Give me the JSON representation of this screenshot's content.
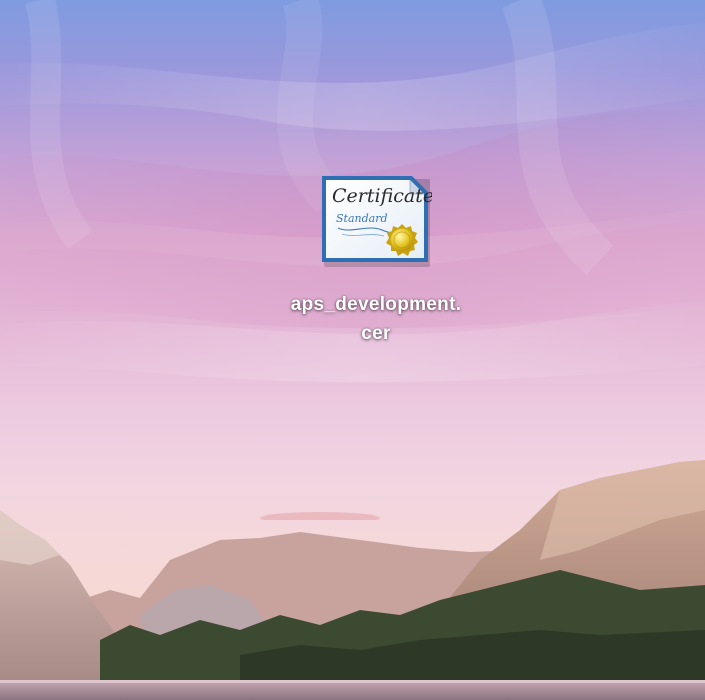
{
  "desktop": {
    "wallpaper": "pink-sky-mountain-lake",
    "files": [
      {
        "name": "aps_development.cer",
        "label_line1": "aps_development.",
        "label_line2": "cer",
        "icon": "certificate-icon",
        "icon_text_title": "Certificate",
        "icon_text_subtitle": "Standard"
      }
    ]
  },
  "colors": {
    "sky_top": "#7f9be0",
    "sky_pink": "#dca8cf",
    "horizon": "#f3cfd0",
    "mountain": "#c9a59a",
    "forest": "#3d4a32",
    "label_text": "#ffffff"
  }
}
